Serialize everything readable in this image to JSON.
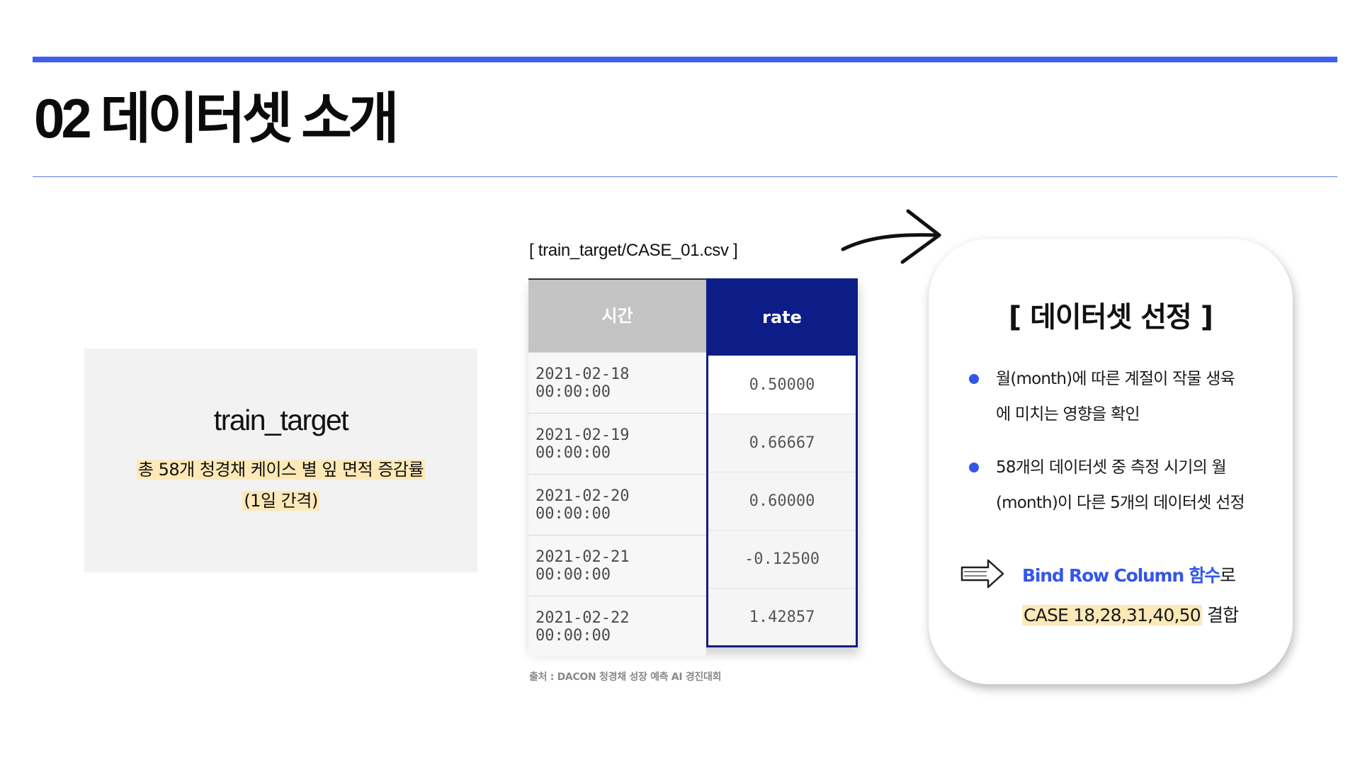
{
  "title": "02 데이터셋 소개",
  "target_card": {
    "title": "train_target",
    "desc_line1": "총 58개 청경채 케이스 별 잎 면적 증감률",
    "desc_line2": "(1일 간격)"
  },
  "table": {
    "file_label": "[ train_target/CASE_01.csv ]",
    "columns": [
      "시간",
      "rate"
    ],
    "rows": [
      {
        "time": "2021-02-18 00:00:00",
        "rate": "0.50000"
      },
      {
        "time": "2021-02-19 00:00:00",
        "rate": "0.66667"
      },
      {
        "time": "2021-02-20 00:00:00",
        "rate": "0.60000"
      },
      {
        "time": "2021-02-21 00:00:00",
        "rate": "-0.12500"
      },
      {
        "time": "2021-02-22 00:00:00",
        "rate": "1.42857"
      }
    ],
    "source": "출처 : DACON 청경채 성장 예측 AI 경진대회"
  },
  "selection_card": {
    "title": "[ 데이터셋 선정 ]",
    "bullets": [
      {
        "line1": "월(month)에 따른 계절이 작물 생육",
        "line2": "에 미치는 영향을 확인"
      },
      {
        "line1": "58개의 데이터셋 중 측정 시기의 월",
        "line2": "(month)이 다른 5개의 데이터셋 선정"
      }
    ],
    "bind_fn": "Bind Row Column 함수",
    "bind_suffix": "로",
    "cases": "CASE 18,28,31,40,50",
    "cases_suffix": " 결합"
  },
  "colors": {
    "accent": "#3d5ef0",
    "navy": "#0d1d87",
    "highlight": "#fde9b8",
    "header_gray": "#c4c4c4"
  },
  "icons": [
    "curved-arrow-icon",
    "hollow-arrow-icon"
  ]
}
